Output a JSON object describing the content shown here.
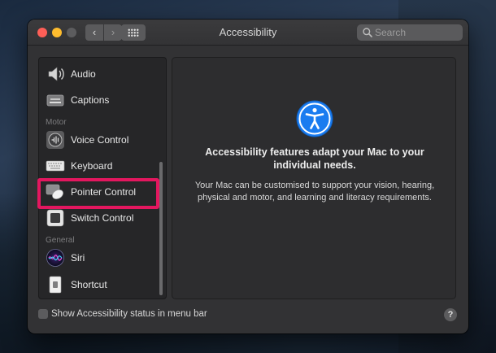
{
  "window": {
    "title": "Accessibility"
  },
  "toolbar": {
    "back_glyph": "‹",
    "forward_glyph": "›",
    "search_placeholder": "Search"
  },
  "sidebar": {
    "items": [
      {
        "label": "Audio",
        "icon": "speaker-icon"
      },
      {
        "label": "Captions",
        "icon": "captions-icon"
      },
      {
        "label": "Voice Control",
        "icon": "voice-control-icon"
      },
      {
        "label": "Keyboard",
        "icon": "keyboard-icon"
      },
      {
        "label": "Pointer Control",
        "icon": "pointer-control-icon"
      },
      {
        "label": "Switch Control",
        "icon": "switch-control-icon"
      },
      {
        "label": "Siri",
        "icon": "siri-icon"
      },
      {
        "label": "Shortcut",
        "icon": "shortcut-icon"
      }
    ],
    "headers": {
      "motor": "Motor",
      "general": "General"
    }
  },
  "main": {
    "headline": "Accessibility features adapt your Mac to your individual needs.",
    "body": "Your Mac can be customised to support your vision, hearing, physical and motor, and learning and literacy requirements."
  },
  "footer": {
    "checkbox_label": "Show Accessibility status in menu bar",
    "checkbox_checked": false,
    "help_glyph": "?"
  },
  "colors": {
    "highlight": "#e3175f",
    "accessibility_blue": "#1a7cf0"
  }
}
